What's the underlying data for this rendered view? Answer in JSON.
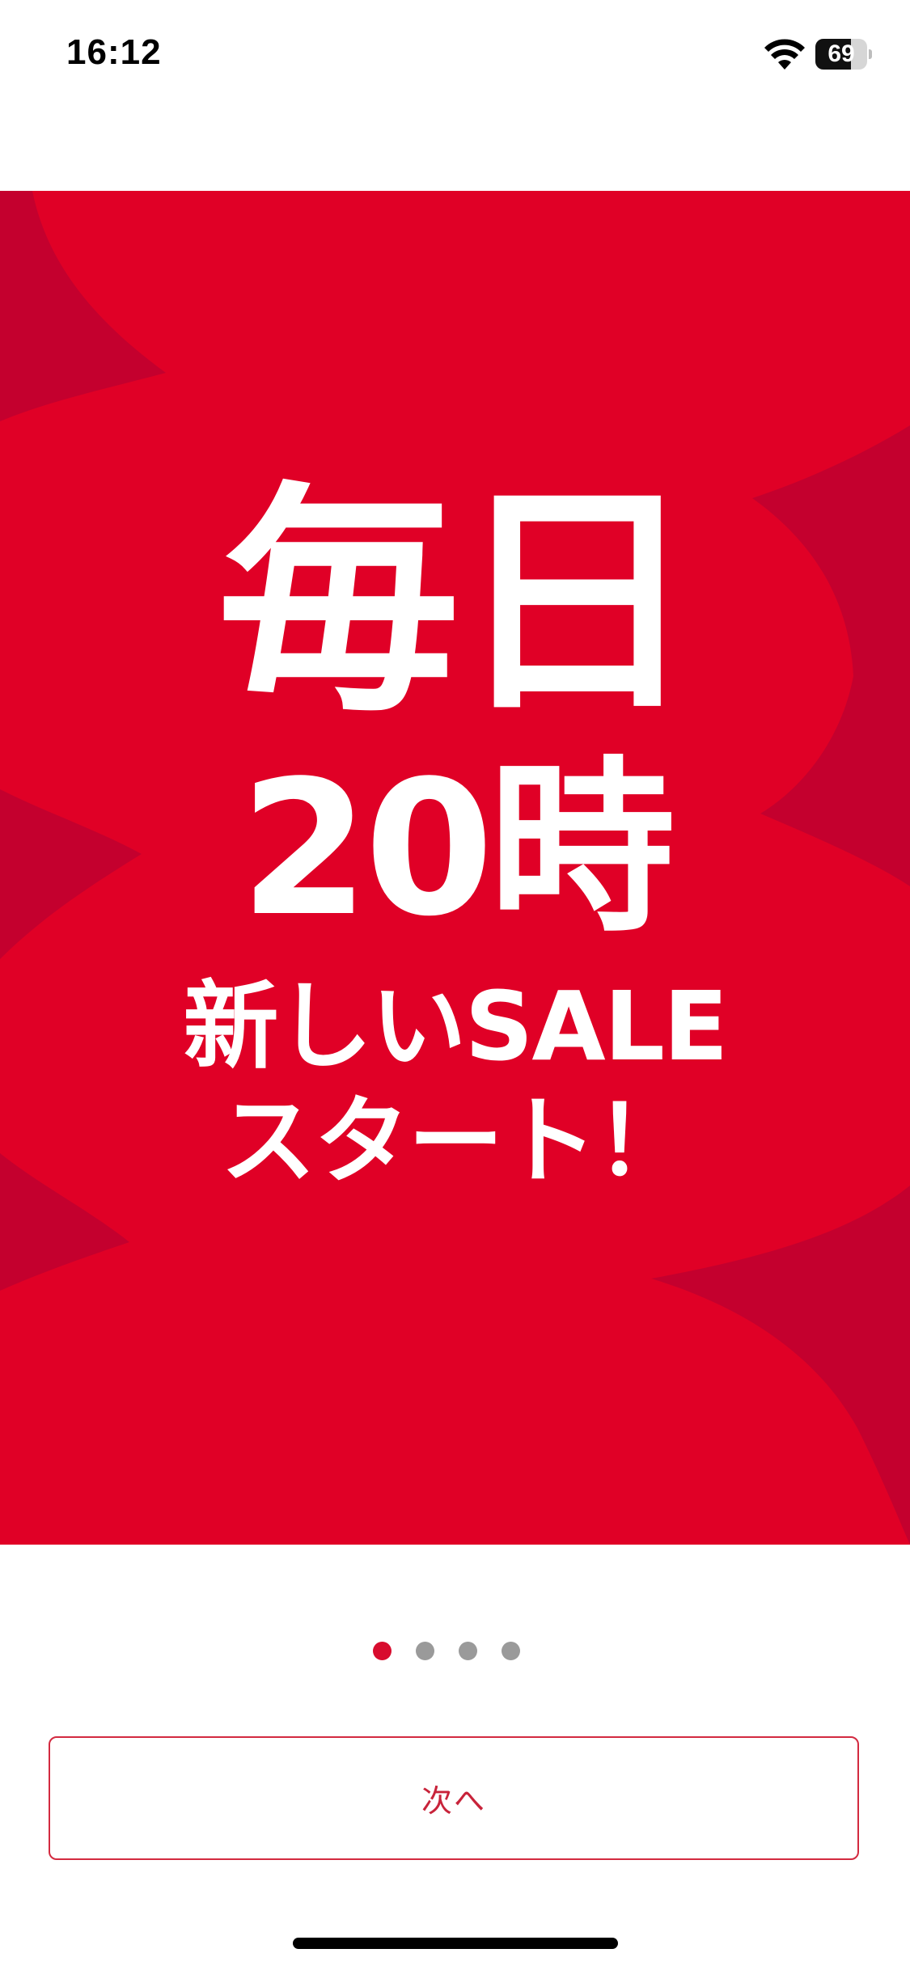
{
  "status_bar": {
    "time": "16:12",
    "battery_level": "69",
    "battery_fraction": 0.69,
    "icons": [
      "wifi-icon",
      "battery-icon"
    ]
  },
  "banner": {
    "line1": "毎日",
    "line2": "20時",
    "line3": "新しいSALE",
    "line4": "スタート！",
    "colors": {
      "background": "#e00026",
      "shape": "#c4002e",
      "text": "#ffffff"
    }
  },
  "pagination": {
    "count": 4,
    "active_index": 0,
    "active_color": "#d80c2e",
    "inactive_color": "#9a9a9a"
  },
  "next_button": {
    "label": "次へ",
    "accent": "#c8233a"
  }
}
